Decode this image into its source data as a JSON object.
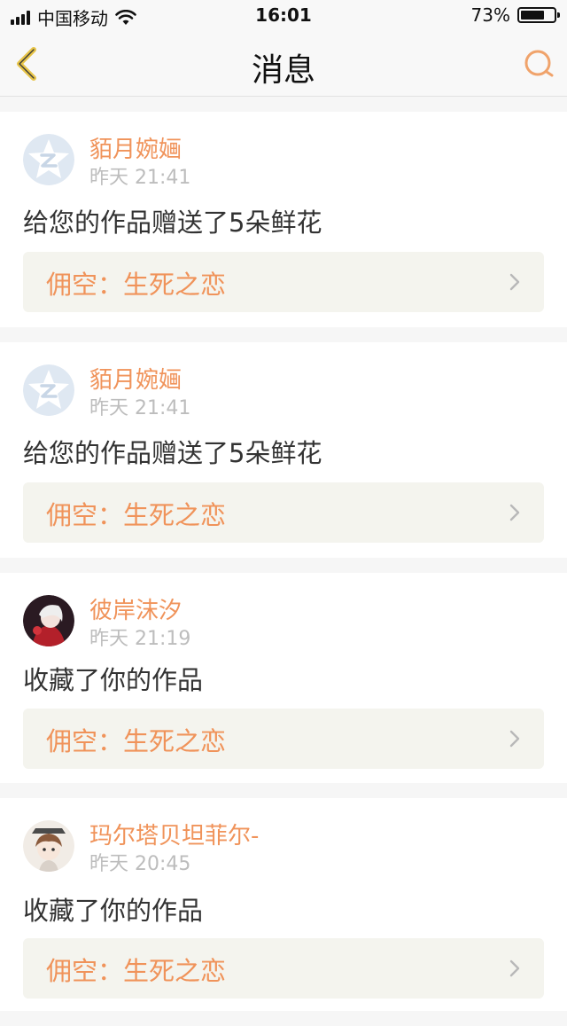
{
  "status_bar": {
    "carrier": "中国移动",
    "time": "16:01",
    "battery_percent": "73%",
    "battery_level": 0.73,
    "icons": [
      "signal-icon",
      "wifi-icon",
      "battery-icon"
    ]
  },
  "navbar": {
    "title": "消息",
    "back_icon": "chevron-left-icon",
    "search_icon": "search-icon"
  },
  "colors": {
    "accent": "#f0935a",
    "back_icon": "#e7c447",
    "time_text": "#bdbdbd",
    "work_card_bg": "#f4f4ee"
  },
  "messages": [
    {
      "user": "貊月婉婳",
      "time": "昨天 21:41",
      "action": "给您的作品赠送了5朵鲜花",
      "work": "佣空：生死之恋",
      "avatar": "default-qq-avatar"
    },
    {
      "user": "貊月婉婳",
      "time": "昨天 21:41",
      "action": "给您的作品赠送了5朵鲜花",
      "work": "佣空：生死之恋",
      "avatar": "default-qq-avatar"
    },
    {
      "user": "彼岸沫汐",
      "time": "昨天 21:19",
      "action": "收藏了你的作品",
      "work": "佣空：生死之恋",
      "avatar": "anime-avatar-dark"
    },
    {
      "user": "玛尔塔贝坦菲尔-",
      "time": "昨天 20:45",
      "action": "收藏了你的作品",
      "work": "佣空：生死之恋",
      "avatar": "anime-avatar-light"
    }
  ]
}
